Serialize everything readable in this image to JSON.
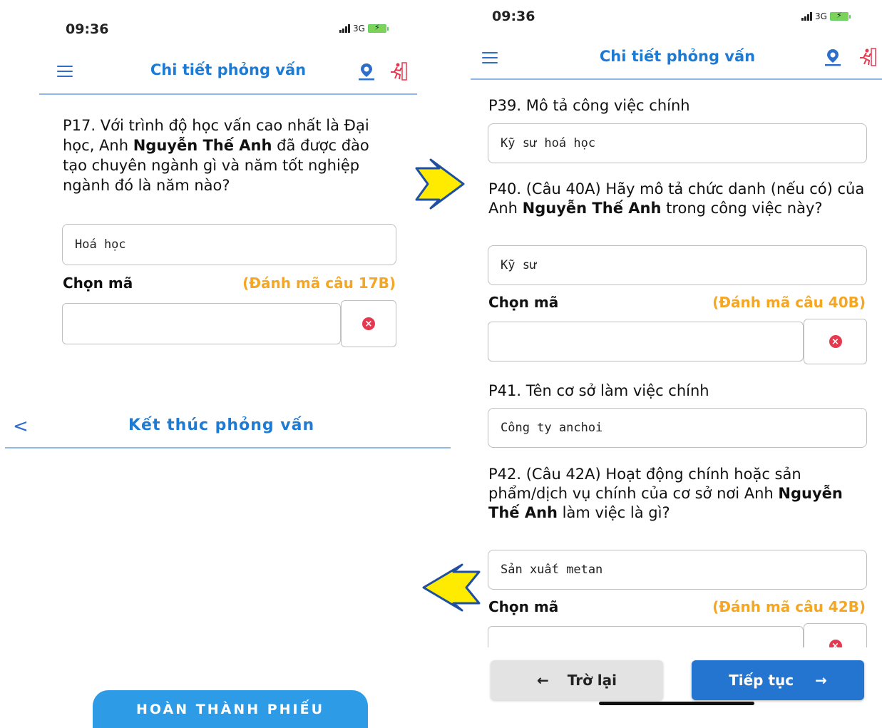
{
  "left": {
    "status": {
      "time": "09:36",
      "network": "3G"
    },
    "header": {
      "title": "Chi tiết phỏng vấn",
      "menu_icon": "hamburger-menu-icon",
      "location_icon": "map-pin-icon",
      "exit_icon": "running-exit-icon"
    },
    "question": {
      "pre": "P17. Với trình độ học vấn cao nhất là Đại học, Anh ",
      "name": "Nguyễn Thế Anh",
      "post": " đã được đào tạo chuyên ngành gì và năm tốt nghiệp ngành đó là năm nào?"
    },
    "answer": "Hoá học",
    "choose_label": "Chọn mã",
    "code_hint": "(Đánh mã câu 17B)",
    "end_bar": {
      "chevron": "<",
      "title": "Kết thúc phỏng vấn"
    },
    "complete_button": "HOÀN THÀNH PHIẾU"
  },
  "right": {
    "status": {
      "time": "09:36",
      "network": "3G"
    },
    "header": {
      "title": "Chi tiết phỏng vấn",
      "menu_icon": "hamburger-menu-icon",
      "location_icon": "map-pin-icon",
      "exit_icon": "running-exit-icon"
    },
    "q39": {
      "title": "P39. Mô tả công việc chính",
      "answer": "Kỹ sư hoá học"
    },
    "q40": {
      "pre": "P40. (Câu 40A) Hãy mô tả chức danh (nếu có) của Anh ",
      "name": "Nguyễn Thế Anh",
      "post": " trong công việc này?",
      "answer": "Kỹ sư",
      "choose_label": "Chọn mã",
      "code_hint": "(Đánh mã câu 40B)"
    },
    "q41": {
      "title": "P41. Tên cơ sở làm việc chính",
      "answer": "Công ty anchoi"
    },
    "q42": {
      "pre": "P42. (Câu 42A) Hoạt động chính hoặc sản phẩm/dịch vụ chính của cơ sở nơi Anh ",
      "name": "Nguyễn Thế Anh",
      "post": " làm việc là gì?",
      "answer": "Sản xuất metan",
      "choose_label": "Chọn mã",
      "code_hint": "(Đánh mã câu 42B)"
    },
    "nav": {
      "back_label": "Trờ lại",
      "back_arrow": "←",
      "next_label": "Tiếp tục",
      "next_arrow": "→"
    }
  },
  "colors": {
    "accent": "#1e7bd4",
    "hint": "#f5a623",
    "arrow": "#ffeb00",
    "arrow_outline": "#1f4fa0",
    "clear": "#e53950"
  }
}
